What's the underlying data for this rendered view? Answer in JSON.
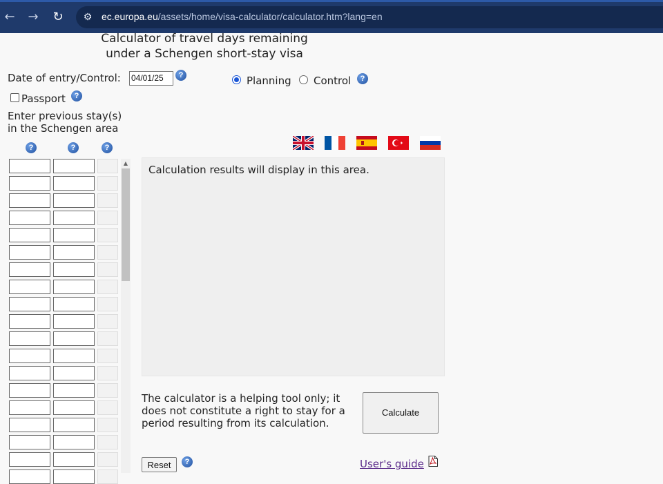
{
  "browser": {
    "back_icon": "←",
    "forward_icon": "→",
    "reload_icon": "↻",
    "site_info_icon": "⚙",
    "url_host": "ec.europa.eu",
    "url_path": "/assets/home/visa-calculator/calculator.htm?lang=en"
  },
  "page": {
    "title_line1": "Calculator of travel days remaining",
    "title_line2": "under a Schengen short-stay visa",
    "date_label": "Date of entry/Control:",
    "date_value": "04/01/25",
    "mode_planning": "Planning",
    "mode_control": "Control",
    "selected_mode": "Planning",
    "passport_label": "Passport",
    "passport_checked": false,
    "stays_label_line1": "Enter previous stay(s)",
    "stays_label_line2": "in the Schengen area",
    "help_glyph": "?",
    "results_text": "Calculation results will display in this area.",
    "disclaimer": "The calculator is a helping tool only; it does not constitute a right to stay for a period resulting from its calculation.",
    "calculate_label": "Calculate",
    "reset_label": "Reset",
    "guide_label": "User's guide",
    "languages": [
      "English",
      "French",
      "Spanish",
      "Turkish",
      "Russian"
    ]
  },
  "colors": {
    "browser_bar": "#1f3a6b",
    "help_icon": "#1f4f9e",
    "link_visited": "#5b2b8a",
    "radio_checked": "#1a56d6"
  }
}
